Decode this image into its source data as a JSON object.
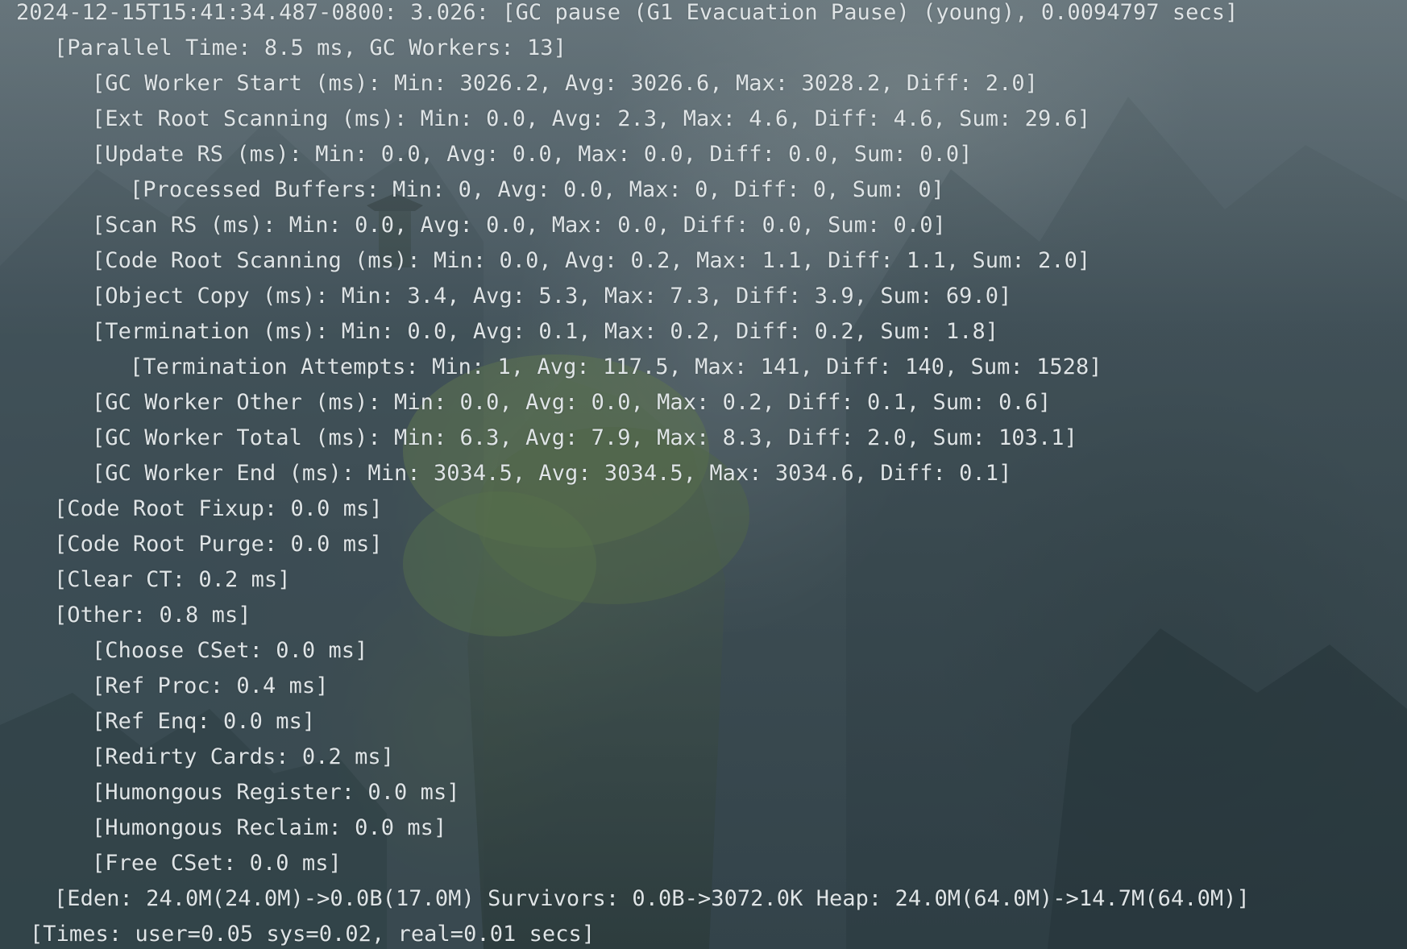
{
  "console": {
    "background_image": "fantasy-mountain-landscape",
    "text_color": "#dfe4e6",
    "lines": [
      "2024-12-15T15:41:34.487-0800: 3.026: [GC pause (G1 Evacuation Pause) (young), 0.0094797 secs]",
      "[Parallel Time: 8.5 ms, GC Workers: 13]",
      "[GC Worker Start (ms): Min: 3026.2, Avg: 3026.6, Max: 3028.2, Diff: 2.0]",
      "[Ext Root Scanning (ms): Min: 0.0, Avg: 2.3, Max: 4.6, Diff: 4.6, Sum: 29.6]",
      "[Update RS (ms): Min: 0.0, Avg: 0.0, Max: 0.0, Diff: 0.0, Sum: 0.0]",
      "[Processed Buffers: Min: 0, Avg: 0.0, Max: 0, Diff: 0, Sum: 0]",
      "[Scan RS (ms): Min: 0.0, Avg: 0.0, Max: 0.0, Diff: 0.0, Sum: 0.0]",
      "[Code Root Scanning (ms): Min: 0.0, Avg: 0.2, Max: 1.1, Diff: 1.1, Sum: 2.0]",
      "[Object Copy (ms): Min: 3.4, Avg: 5.3, Max: 7.3, Diff: 3.9, Sum: 69.0]",
      "[Termination (ms): Min: 0.0, Avg: 0.1, Max: 0.2, Diff: 0.2, Sum: 1.8]",
      "[Termination Attempts: Min: 1, Avg: 117.5, Max: 141, Diff: 140, Sum: 1528]",
      "[GC Worker Other (ms): Min: 0.0, Avg: 0.0, Max: 0.2, Diff: 0.1, Sum: 0.6]",
      "[GC Worker Total (ms): Min: 6.3, Avg: 7.9, Max: 8.3, Diff: 2.0, Sum: 103.1]",
      "[GC Worker End (ms): Min: 3034.5, Avg: 3034.5, Max: 3034.6, Diff: 0.1]",
      "[Code Root Fixup: 0.0 ms]",
      "[Code Root Purge: 0.0 ms]",
      "[Clear CT: 0.2 ms]",
      "[Other: 0.8 ms]",
      "[Choose CSet: 0.0 ms]",
      "[Ref Proc: 0.4 ms]",
      "[Ref Enq: 0.0 ms]",
      "[Redirty Cards: 0.2 ms]",
      "[Humongous Register: 0.0 ms]",
      "[Humongous Reclaim: 0.0 ms]",
      "[Free CSet: 0.0 ms]",
      "[Eden: 24.0M(24.0M)->0.0B(17.0M) Survivors: 0.0B->3072.0K Heap: 24.0M(64.0M)->14.7M(64.0M)]",
      "[Times: user=0.05 sys=0.02, real=0.01 secs]"
    ]
  }
}
